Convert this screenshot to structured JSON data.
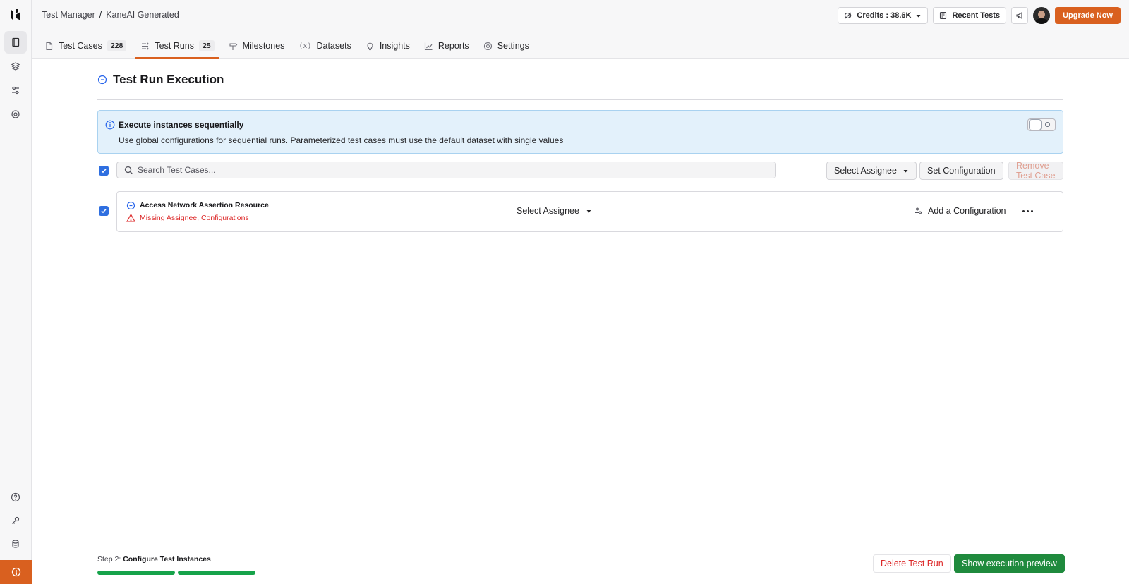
{
  "breadcrumb": {
    "root": "Test Manager",
    "separator": "/",
    "current": "KaneAI Generated"
  },
  "header": {
    "credits_label": "Credits : 38.6K",
    "recent_tests_label": "Recent Tests",
    "upgrade_label": "Upgrade Now"
  },
  "tabs": [
    {
      "label": "Test Cases",
      "count": "228",
      "icon": "test-case-icon"
    },
    {
      "label": "Test Runs",
      "count": "25",
      "icon": "test-run-icon",
      "active": true
    },
    {
      "label": "Milestones",
      "icon": "milestone-icon"
    },
    {
      "label": "Datasets",
      "icon": "dataset-icon"
    },
    {
      "label": "Insights",
      "icon": "lightbulb-icon"
    },
    {
      "label": "Reports",
      "icon": "chart-icon"
    },
    {
      "label": "Settings",
      "icon": "gear-icon"
    }
  ],
  "page": {
    "title": "Test Run Execution"
  },
  "info_banner": {
    "heading": "Execute instances sequentially",
    "description": "Use global configurations for sequential runs. Parameterized test cases must use the default dataset with single values",
    "toggle_on": false
  },
  "toolbar": {
    "search_placeholder": "Search Test Cases...",
    "select_assignee_label": "Select Assignee",
    "set_configuration_label": "Set Configuration",
    "remove_label": "Remove Test Case"
  },
  "test_cases": [
    {
      "name": "Access Network Assertion Resource",
      "warning": "Missing Assignee, Configurations",
      "assignee_label": "Select Assignee",
      "add_config_label": "Add a Configuration"
    }
  ],
  "footer": {
    "step_prefix": "Step 2:",
    "step_name": "Configure Test Instances",
    "progress_completed_steps": 2,
    "progress_total_steps": 2,
    "delete_label": "Delete Test Run",
    "preview_label": "Show execution preview"
  },
  "colors": {
    "accent": "#d9601f",
    "primary_action": "#1f8a3d",
    "info_bg": "#e3f1fb",
    "danger": "#dc2626"
  }
}
